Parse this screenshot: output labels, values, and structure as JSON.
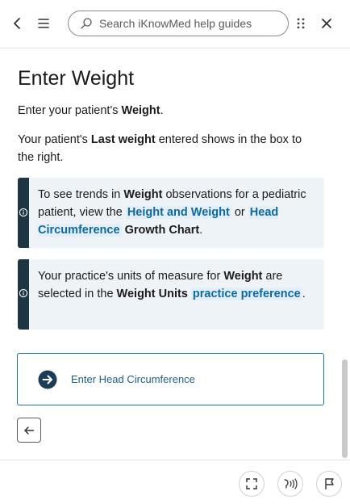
{
  "header": {
    "search_placeholder": "Search iKnowMed help guides",
    "icons": [
      "chevron-left-icon",
      "menu-icon",
      "search-icon",
      "apps-grid-icon",
      "close-icon"
    ]
  },
  "article": {
    "title": "Enter Weight",
    "p1": {
      "pre": "Enter your patient's ",
      "bold": "Weight",
      "post": "."
    },
    "p2": {
      "pre": "Your patient's ",
      "bold": "Last weight",
      "post": " entered shows in the box to the right."
    },
    "note1": {
      "t1": "To see trends in ",
      "b1": "Weight",
      "t2": " observations for a pediatric patient, view the ",
      "link1": "Height and Weight",
      "t3": " or ",
      "link2": "Head Circumference",
      "t4": " ",
      "b2": "Growth Chart",
      "t5": "."
    },
    "note2": {
      "t1": "Your practice's units of measure for ",
      "b1": "Weight",
      "t2": " are selected in the ",
      "b2": "Weight Units",
      "t3": " ",
      "link1": "practice preference",
      "t4": "."
    },
    "next_card_label": "Enter Head Circumference"
  },
  "footer": {
    "icons": [
      "fullscreen-icon",
      "read-aloud-icon",
      "flag-icon"
    ]
  },
  "colors": {
    "accent": "#0b6aa2",
    "note_bar": "#1d3642",
    "note_bg": "#eef3f8",
    "card_border": "#1d6fa5"
  }
}
